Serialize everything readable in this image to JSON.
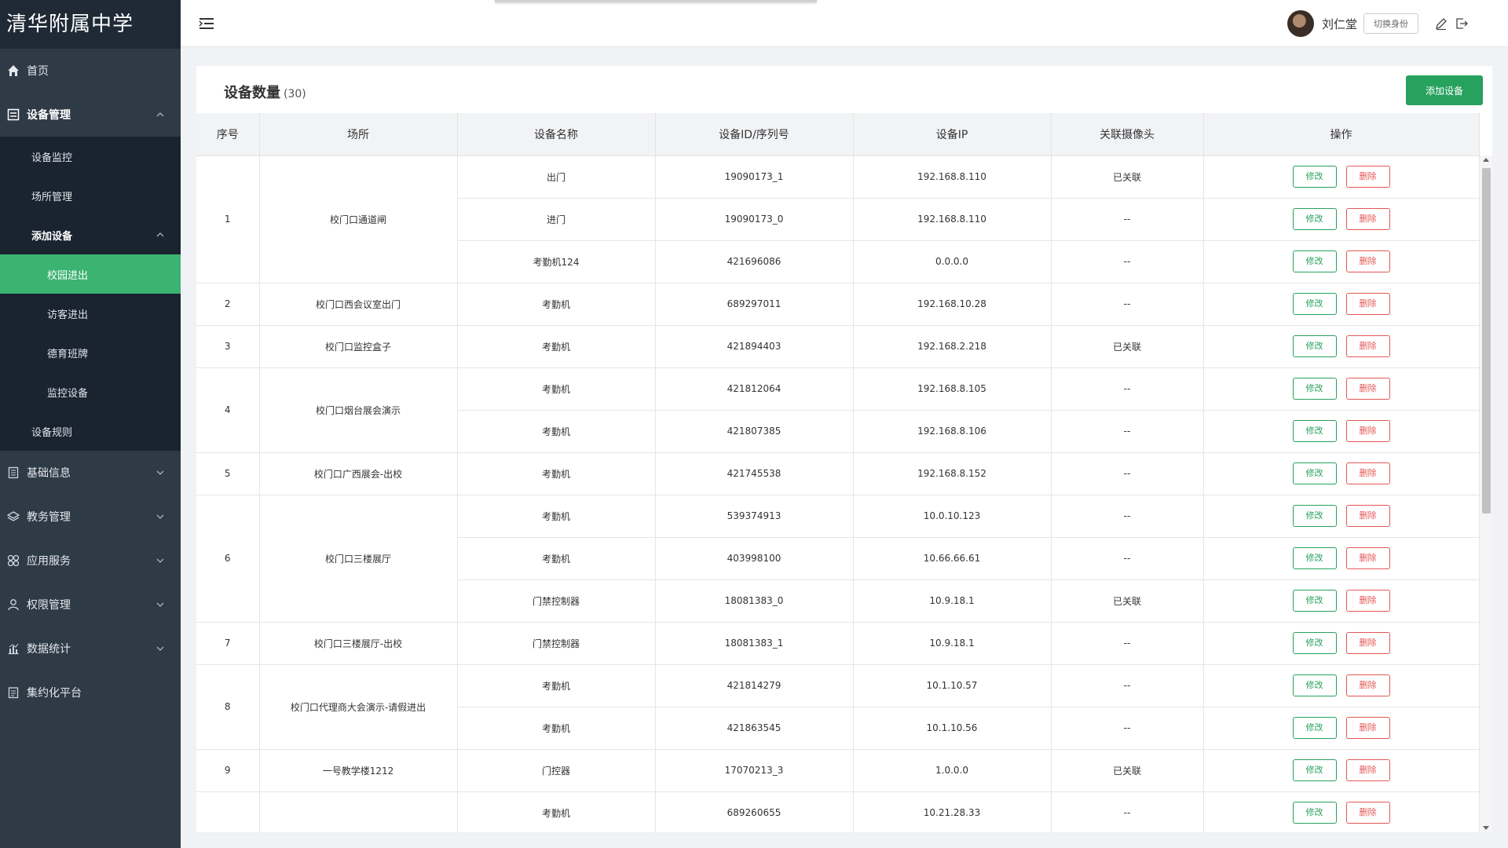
{
  "brand": "清华附属中学",
  "sidebar": {
    "home": "首页",
    "device_mgmt": "设备管理",
    "device_monitor": "设备监控",
    "venue_mgmt": "场所管理",
    "add_device": "添加设备",
    "campus_in_out": "校园进出",
    "visitor_in_out": "访客进出",
    "moral_board": "德育班牌",
    "monitor_device": "监控设备",
    "device_rules": "设备规则",
    "basic_info": "基础信息",
    "academic_mgmt": "教务管理",
    "app_services": "应用服务",
    "permission_mgmt": "权限管理",
    "data_stats": "数据统计",
    "intensive_platform": "集约化平台"
  },
  "header": {
    "username": "刘仁堂",
    "switch_identity": "切换身份"
  },
  "content": {
    "title": "设备数量",
    "count": "(30)",
    "add_button": "添加设备"
  },
  "table": {
    "columns": [
      "序号",
      "场所",
      "设备名称",
      "设备ID/序列号",
      "设备IP",
      "关联摄像头",
      "操作"
    ],
    "edit_label": "修改",
    "delete_label": "删除",
    "groups": [
      {
        "no": "1",
        "venue": "校门口通道闸",
        "rows": [
          {
            "name": "出门",
            "id": "19090173_1",
            "ip": "192.168.8.110",
            "camera": "已关联"
          },
          {
            "name": "进门",
            "id": "19090173_0",
            "ip": "192.168.8.110",
            "camera": "--"
          },
          {
            "name": "考勤机124",
            "id": "421696086",
            "ip": "0.0.0.0",
            "camera": "--"
          }
        ]
      },
      {
        "no": "2",
        "venue": "校门口西会议室出门",
        "rows": [
          {
            "name": "考勤机",
            "id": "689297011",
            "ip": "192.168.10.28",
            "camera": "--"
          }
        ]
      },
      {
        "no": "3",
        "venue": "校门口监控盒子",
        "rows": [
          {
            "name": "考勤机",
            "id": "421894403",
            "ip": "192.168.2.218",
            "camera": "已关联"
          }
        ]
      },
      {
        "no": "4",
        "venue": "校门口烟台展会演示",
        "rows": [
          {
            "name": "考勤机",
            "id": "421812064",
            "ip": "192.168.8.105",
            "camera": "--"
          },
          {
            "name": "考勤机",
            "id": "421807385",
            "ip": "192.168.8.106",
            "camera": "--"
          }
        ]
      },
      {
        "no": "5",
        "venue": "校门口广西展会-出校",
        "rows": [
          {
            "name": "考勤机",
            "id": "421745538",
            "ip": "192.168.8.152",
            "camera": "--"
          }
        ]
      },
      {
        "no": "6",
        "venue": "校门口三楼展厅",
        "rows": [
          {
            "name": "考勤机",
            "id": "539374913",
            "ip": "10.0.10.123",
            "camera": "--"
          },
          {
            "name": "考勤机",
            "id": "403998100",
            "ip": "10.66.66.61",
            "camera": "--"
          },
          {
            "name": "门禁控制器",
            "id": "18081383_0",
            "ip": "10.9.18.1",
            "camera": "已关联"
          }
        ]
      },
      {
        "no": "7",
        "venue": "校门口三楼展厅-出校",
        "rows": [
          {
            "name": "门禁控制器",
            "id": "18081383_1",
            "ip": "10.9.18.1",
            "camera": "--"
          }
        ]
      },
      {
        "no": "8",
        "venue": "校门口代理商大会演示-请假进出",
        "rows": [
          {
            "name": "考勤机",
            "id": "421814279",
            "ip": "10.1.10.57",
            "camera": "--"
          },
          {
            "name": "考勤机",
            "id": "421863545",
            "ip": "10.1.10.56",
            "camera": "--"
          }
        ]
      },
      {
        "no": "9",
        "venue": "一号教学楼1212",
        "rows": [
          {
            "name": "门控器",
            "id": "17070213_3",
            "ip": "1.0.0.0",
            "camera": "已关联"
          }
        ]
      },
      {
        "no": "",
        "venue": "",
        "rows": [
          {
            "name": "考勤机",
            "id": "689260655",
            "ip": "10.21.28.33",
            "camera": "--"
          }
        ]
      }
    ]
  },
  "colors": {
    "accent": "#3cb371",
    "sidebar_bg": "#2f3a47",
    "danger": "#e45656"
  }
}
